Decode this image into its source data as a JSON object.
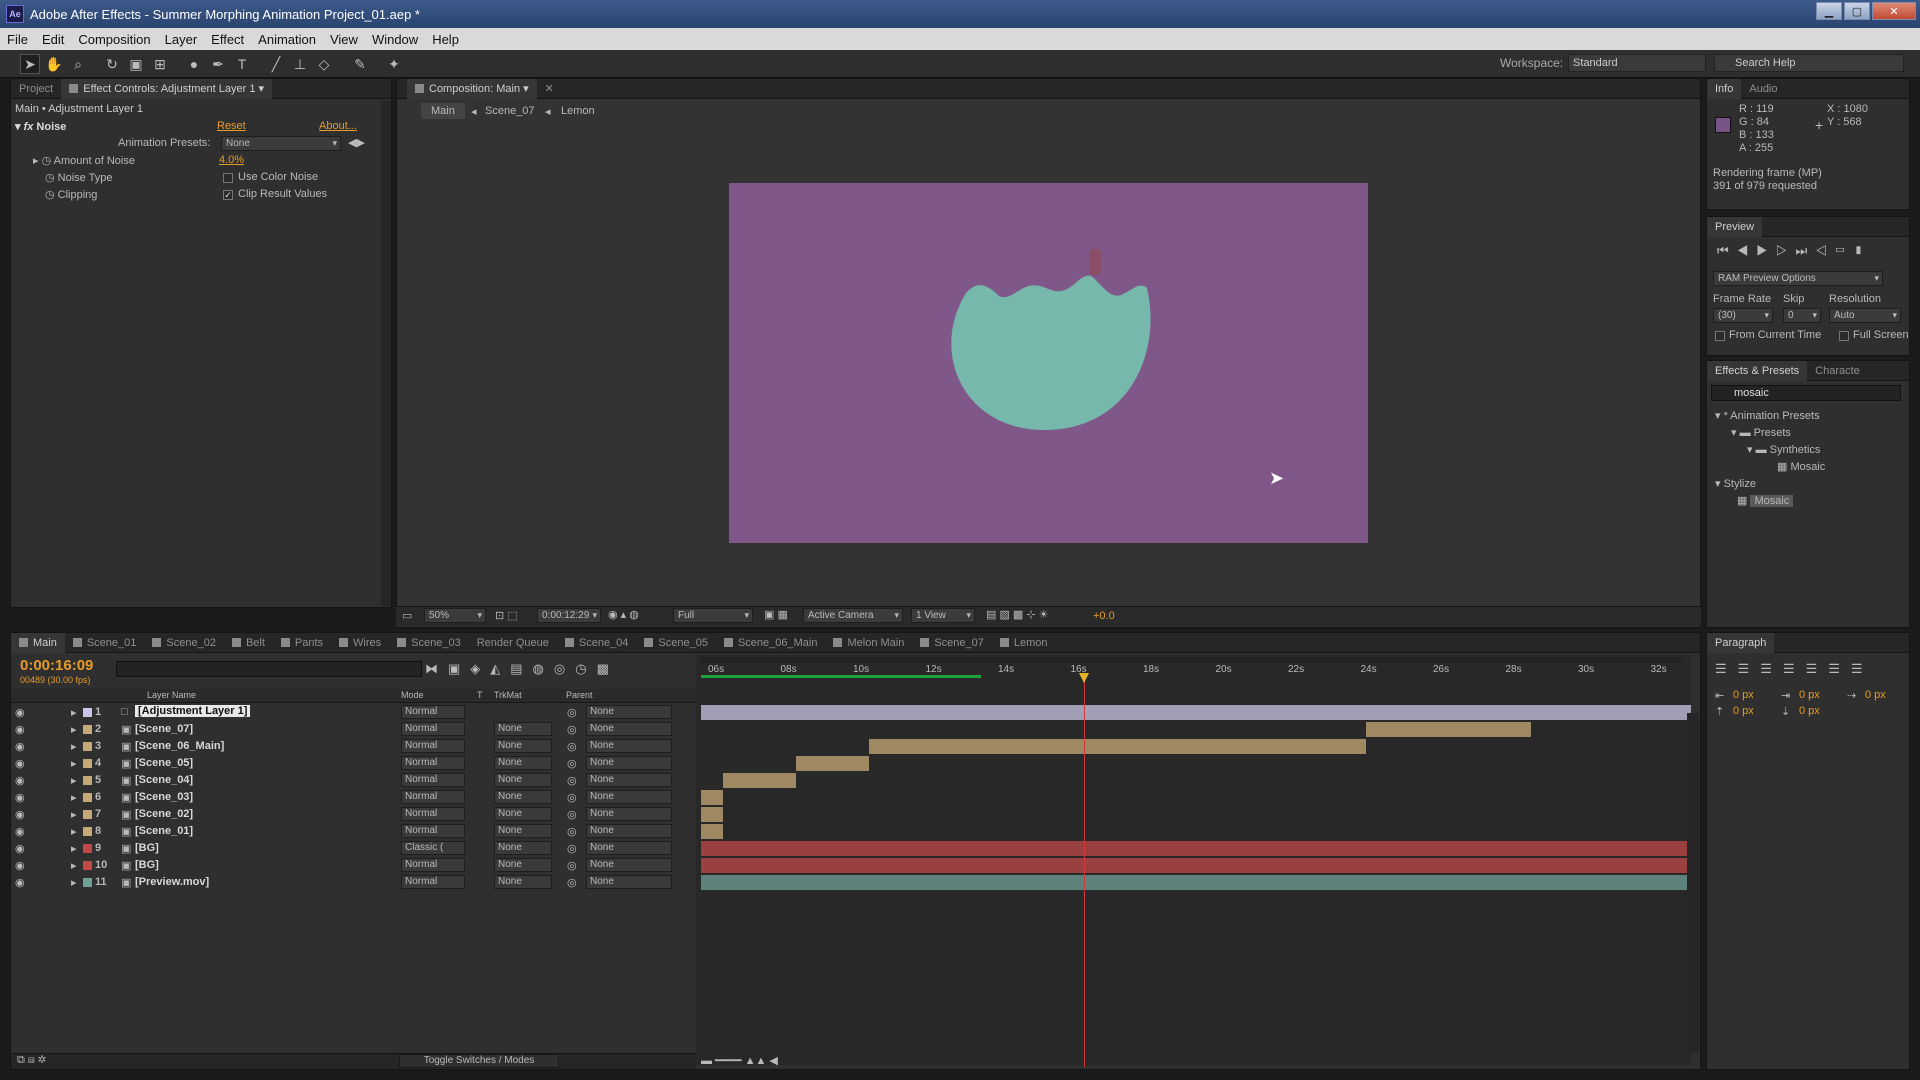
{
  "app": {
    "title": "Adobe After Effects - Summer Morphing Animation Project_01.aep *",
    "icon": "Ae"
  },
  "menu": [
    "File",
    "Edit",
    "Composition",
    "Layer",
    "Effect",
    "Animation",
    "View",
    "Window",
    "Help"
  ],
  "workspace": {
    "label": "Workspace:",
    "value": "Standard",
    "search_placeholder": "Search Help"
  },
  "effect_controls": {
    "tabs": [
      "Project",
      "Effect Controls: Adjustment Layer 1"
    ],
    "breadcrumb": "Main • Adjustment Layer 1",
    "effect": "Noise",
    "reset": "Reset",
    "about": "About...",
    "presets_label": "Animation Presets:",
    "presets_value": "None",
    "amount_label": "Amount of Noise",
    "amount_value": "4.0%",
    "noise_type_label": "Noise Type",
    "use_color_noise": "Use Color Noise",
    "clipping_label": "Clipping",
    "clip_result": "Clip Result Values"
  },
  "composition": {
    "tab": "Composition: Main",
    "breadcrumbs": [
      "Main",
      "Scene_07",
      "Lemon"
    ],
    "zoom": "50%",
    "timecode": "0:00:12:29",
    "resolution": "Full",
    "camera": "Active Camera",
    "view": "1 View",
    "exposure": "+0.0",
    "bg_color": "#7f5889",
    "shape_color": "#77b8ad"
  },
  "info": {
    "tabs": [
      "Info",
      "Audio"
    ],
    "r": "R : 119",
    "g": "G : 84",
    "b": "B : 133",
    "a": "A : 255",
    "x": "X : 1080",
    "y": "Y : 568",
    "status1": "Rendering frame (MP)",
    "status2": "391 of 979 requested",
    "swatch": "#775485"
  },
  "preview": {
    "tab": "Preview",
    "ram": "RAM Preview Options",
    "frame_rate_label": "Frame Rate",
    "skip_label": "Skip",
    "resolution_label": "Resolution",
    "frame_rate": "(30)",
    "skip": "0",
    "resolution": "Auto",
    "from_current": "From Current Time",
    "full_screen": "Full Screen"
  },
  "effects_presets": {
    "tabs": [
      "Effects & Presets",
      "Characte"
    ],
    "search": "mosaic",
    "tree": [
      "* Animation Presets",
      "Presets",
      "Synthetics",
      "Mosaic",
      "Stylize",
      "Mosaic"
    ]
  },
  "paragraph": {
    "tab": "Paragraph",
    "v1": "0 px",
    "v2": "0 px",
    "v3": "0 px",
    "v4": "0 px",
    "v5": "0 px"
  },
  "timeline": {
    "tabs": [
      "Main",
      "Scene_01",
      "Scene_02",
      "Belt",
      "Pants",
      "Wires",
      "Scene_03",
      "Render Queue",
      "Scene_04",
      "Scene_05",
      "Scene_06_Main",
      "Melon Main",
      "Scene_07",
      "Lemon"
    ],
    "timecode": "0:00:16:09",
    "frames": "00489 (30.00 fps)",
    "headers": {
      "layer_name": "Layer Name",
      "mode": "Mode",
      "t": "T",
      "trkmat": "TrkMat",
      "parent": "Parent"
    },
    "ruler": [
      "06s",
      "08s",
      "10s",
      "12s",
      "14s",
      "16s",
      "18s",
      "20s",
      "22s",
      "24s",
      "26s",
      "28s",
      "30s",
      "32s"
    ],
    "toggle": "Toggle Switches / Modes",
    "layers": [
      {
        "num": "1",
        "name": "[Adjustment Layer 1]",
        "mode": "Normal",
        "trkmat": "",
        "parent": "None",
        "color": "#cbc6e6"
      },
      {
        "num": "2",
        "name": "[Scene_07]",
        "mode": "Normal",
        "trkmat": "None",
        "parent": "None",
        "color": "#c5a977"
      },
      {
        "num": "3",
        "name": "[Scene_06_Main]",
        "mode": "Normal",
        "trkmat": "None",
        "parent": "None",
        "color": "#c5a977"
      },
      {
        "num": "4",
        "name": "[Scene_05]",
        "mode": "Normal",
        "trkmat": "None",
        "parent": "None",
        "color": "#c5a977"
      },
      {
        "num": "5",
        "name": "[Scene_04]",
        "mode": "Normal",
        "trkmat": "None",
        "parent": "None",
        "color": "#c5a977"
      },
      {
        "num": "6",
        "name": "[Scene_03]",
        "mode": "Normal",
        "trkmat": "None",
        "parent": "None",
        "color": "#c5a977"
      },
      {
        "num": "7",
        "name": "[Scene_02]",
        "mode": "Normal",
        "trkmat": "None",
        "parent": "None",
        "color": "#c5a977"
      },
      {
        "num": "8",
        "name": "[Scene_01]",
        "mode": "Normal",
        "trkmat": "None",
        "parent": "None",
        "color": "#c5a977"
      },
      {
        "num": "9",
        "name": "[BG]",
        "mode": "Classic (",
        "trkmat": "None",
        "parent": "None",
        "color": "#c04848"
      },
      {
        "num": "10",
        "name": "[BG]",
        "mode": "Normal",
        "trkmat": "None",
        "parent": "None",
        "color": "#c04848"
      },
      {
        "num": "11",
        "name": "[Preview.mov]",
        "mode": "Normal",
        "trkmat": "None",
        "parent": "None",
        "color": "#6fa198"
      }
    ]
  }
}
